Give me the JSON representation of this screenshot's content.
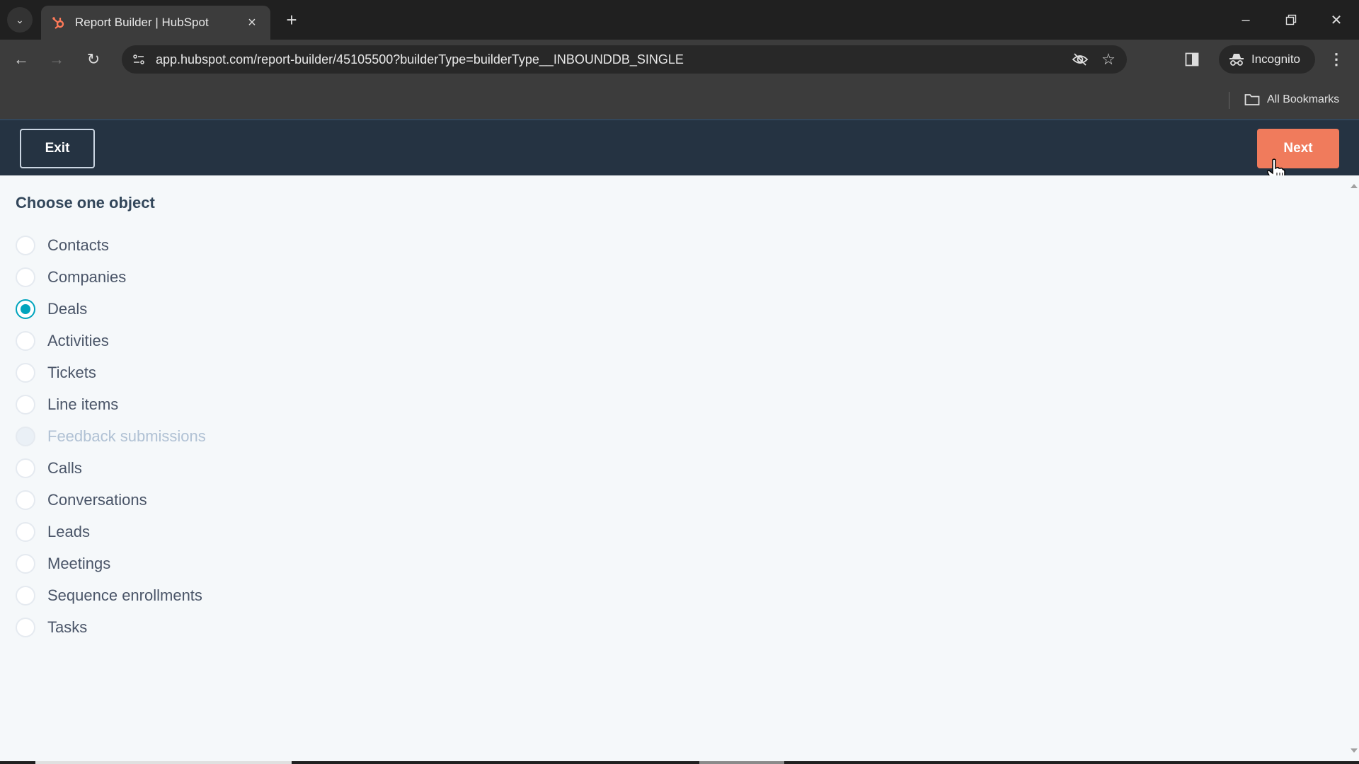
{
  "browser": {
    "tab": {
      "title": "Report Builder | HubSpot",
      "favicon": "hubspot-sprocket-icon"
    },
    "url": "app.hubspot.com/report-builder/45105500?builderType=builderType__INBOUNDDB_SINGLE",
    "incognito_label": "Incognito",
    "bookmarks_label": "All Bookmarks",
    "colors": {
      "favicon": "#ff7a59"
    }
  },
  "header": {
    "exit_label": "Exit",
    "next_label": "Next",
    "colors": {
      "background": "#253342",
      "next_button": "#f07b5c"
    }
  },
  "main": {
    "heading": "Choose one object",
    "selected": "Deals",
    "options": [
      {
        "label": "Contacts",
        "checked": false,
        "disabled": false
      },
      {
        "label": "Companies",
        "checked": false,
        "disabled": false
      },
      {
        "label": "Deals",
        "checked": true,
        "disabled": false
      },
      {
        "label": "Activities",
        "checked": false,
        "disabled": false
      },
      {
        "label": "Tickets",
        "checked": false,
        "disabled": false
      },
      {
        "label": "Line items",
        "checked": false,
        "disabled": false
      },
      {
        "label": "Feedback submissions",
        "checked": false,
        "disabled": true
      },
      {
        "label": "Calls",
        "checked": false,
        "disabled": false
      },
      {
        "label": "Conversations",
        "checked": false,
        "disabled": false
      },
      {
        "label": "Leads",
        "checked": false,
        "disabled": false
      },
      {
        "label": "Meetings",
        "checked": false,
        "disabled": false
      },
      {
        "label": "Sequence enrollments",
        "checked": false,
        "disabled": false
      },
      {
        "label": "Tasks",
        "checked": false,
        "disabled": false
      }
    ],
    "colors": {
      "radio_selected": "#00a4bd",
      "text": "#4a5568",
      "disabled_text": "#b0c1d4"
    }
  }
}
